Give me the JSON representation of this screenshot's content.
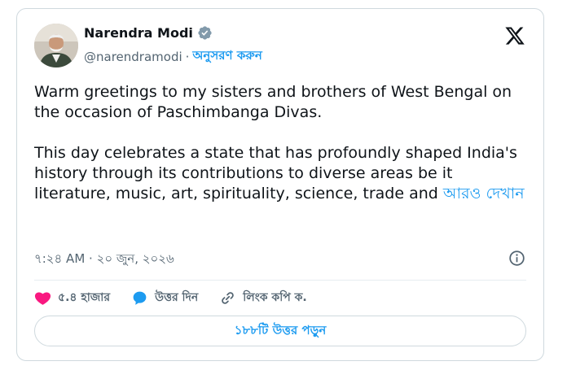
{
  "author": {
    "name": "Narendra Modi",
    "handle": "@narendramodi",
    "separator": "·",
    "follow_label": "অনুসরণ করুন",
    "verified_color": "#829aab"
  },
  "tweet": {
    "paragraph1": "Warm greetings to my sisters and brothers of West Bengal on the occasion of Paschimbanga Divas.",
    "paragraph2": "This day celebrates a state that has profoundly shaped India's history through its contributions to diverse areas be it literature, music, art, spirituality, science, trade and",
    "show_more": "আরও দেখান"
  },
  "timestamp": "৭:২৪ AM · ২০ জুন, ২০২৬",
  "actions": {
    "likes": "৫.৪ হাজার",
    "reply": "উত্তর দিন",
    "copy_link": "লিংক কপি ক."
  },
  "read_replies": "১৮৮টি উত্তর পড়ুন",
  "colors": {
    "accent": "#1d9bf0",
    "like": "#f91880",
    "muted": "#536471",
    "border": "#cfd9de"
  }
}
